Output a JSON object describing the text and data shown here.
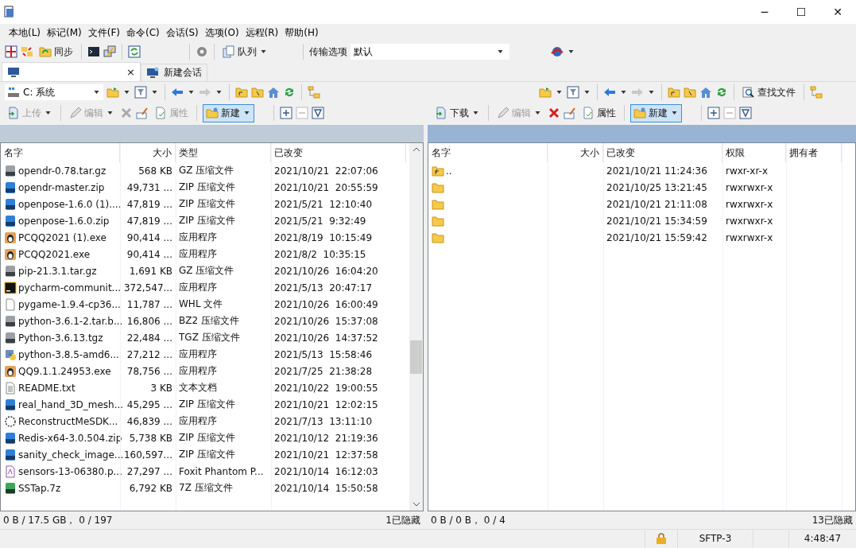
{
  "window": {
    "controls": [
      "─",
      "☐",
      "✕"
    ]
  },
  "menu": [
    "本地(L)",
    "标记(M)",
    "文件(F)",
    "命令(C)",
    "会话(S)",
    "选项(O)",
    "远程(R)",
    "帮助(H)"
  ],
  "toolbar": {
    "sync_label": "同步",
    "queue_label": "队列",
    "transfer_label": "传输选项",
    "transfer_value": "默认"
  },
  "tabs": [
    {
      "close": "×",
      "selected": true
    },
    {
      "label": "新建会话",
      "selected": false
    }
  ],
  "left": {
    "drive": "C: 系统",
    "actions": [
      {
        "label": "上传",
        "disabled": true,
        "dropdown": true
      },
      {
        "label": "编辑",
        "disabled": true,
        "dropdown": true
      },
      {
        "label": "属性",
        "disabled": true,
        "dropdown": false
      },
      {
        "label": "新建",
        "disabled": false,
        "dropdown": true
      }
    ],
    "columns": [
      "名字",
      "大小",
      "类型",
      "已改变"
    ],
    "rows": [
      {
        "kind": "archive",
        "name": "opendr-0.78.tar.gz",
        "size": "568 KB",
        "type": "GZ 压缩文件",
        "modified": "2021/10/21  22:07:06"
      },
      {
        "kind": "zip",
        "name": "opendr-master.zip",
        "size": "49,731 ...",
        "type": "ZIP 压缩文件",
        "modified": "2021/10/21  20:55:59"
      },
      {
        "kind": "zip",
        "name": "openpose-1.6.0 (1)....",
        "size": "47,819 ...",
        "type": "ZIP 压缩文件",
        "modified": "2021/5/21  12:10:40"
      },
      {
        "kind": "zip",
        "name": "openpose-1.6.0.zip",
        "size": "47,819 ...",
        "type": "ZIP 压缩文件",
        "modified": "2021/5/21  9:32:49"
      },
      {
        "kind": "penguin",
        "name": "PCQQ2021 (1).exe",
        "size": "90,414 ...",
        "type": "应用程序",
        "modified": "2021/8/19  10:15:49"
      },
      {
        "kind": "penguin",
        "name": "PCQQ2021.exe",
        "size": "90,414 ...",
        "type": "应用程序",
        "modified": "2021/8/2  10:35:15"
      },
      {
        "kind": "archive",
        "name": "pip-21.3.1.tar.gz",
        "size": "1,691 KB",
        "type": "GZ 压缩文件",
        "modified": "2021/10/26  16:04:20"
      },
      {
        "kind": "ide",
        "name": "pycharm-communit...",
        "size": "372,547...",
        "type": "应用程序",
        "modified": "2021/5/13  20:47:17"
      },
      {
        "kind": "file",
        "name": "pygame-1.9.4-cp36...",
        "size": "11,787 ...",
        "type": "WHL 文件",
        "modified": "2021/10/26  16:00:49"
      },
      {
        "kind": "archive",
        "name": "python-3.6.1-2.tar.b...",
        "size": "16,806 ...",
        "type": "BZ2 压缩文件",
        "modified": "2021/10/26  15:37:08"
      },
      {
        "kind": "archive",
        "name": "Python-3.6.13.tgz",
        "size": "22,484 ...",
        "type": "TGZ 压缩文件",
        "modified": "2021/10/26  14:37:52"
      },
      {
        "kind": "installer",
        "name": "python-3.8.5-amd6...",
        "size": "27,212 ...",
        "type": "应用程序",
        "modified": "2021/5/13  15:58:46"
      },
      {
        "kind": "penguin",
        "name": "QQ9.1.1.24953.exe",
        "size": "78,756 ...",
        "type": "应用程序",
        "modified": "2021/7/25  21:38:28"
      },
      {
        "kind": "text",
        "name": "README.txt",
        "size": "3 KB",
        "type": "文本文档",
        "modified": "2021/10/22  19:00:55"
      },
      {
        "kind": "zip",
        "name": "real_hand_3D_mesh...",
        "size": "45,295 ...",
        "type": "ZIP 压缩文件",
        "modified": "2021/10/21  12:02:15"
      },
      {
        "kind": "ring",
        "name": "ReconstructMeSDK...",
        "size": "46,839 ...",
        "type": "应用程序",
        "modified": "2021/7/13  13:11:10"
      },
      {
        "kind": "zip",
        "name": "Redis-x64-3.0.504.zip",
        "size": "5,738 KB",
        "type": "ZIP 压缩文件",
        "modified": "2021/10/12  21:19:36"
      },
      {
        "kind": "zip",
        "name": "sanity_check_image...",
        "size": "160,597...",
        "type": "ZIP 压缩文件",
        "modified": "2021/10/21  12:37:58"
      },
      {
        "kind": "pdf",
        "name": "sensors-13-06380.p...",
        "size": "27,297 ...",
        "type": "Foxit Phantom P...",
        "modified": "2021/10/14  16:12:03"
      },
      {
        "kind": "archive7z",
        "name": "SSTap.7z",
        "size": "6,792 KB",
        "type": "7Z 压缩文件",
        "modified": "2021/10/14  15:50:58"
      }
    ],
    "status": "0 B / 17.5 GB， 0 / 197",
    "hidden": "1已隐藏"
  },
  "right": {
    "find_label": "查找文件",
    "actions": [
      {
        "label": "下载",
        "disabled": false,
        "dropdown": true
      },
      {
        "label": "编辑",
        "disabled": true,
        "dropdown": true
      },
      {
        "label": "属性",
        "disabled": false,
        "dropdown": false
      },
      {
        "label": "新建",
        "disabled": false,
        "dropdown": true
      }
    ],
    "columns": [
      "名字",
      "大小",
      "已改变",
      "权限",
      "拥有者"
    ],
    "rows": [
      {
        "kind": "parent",
        "name": "..",
        "modified": "2021/10/21 11:24:36",
        "rights": "rwxr-xr-x"
      },
      {
        "kind": "folder",
        "modified": "2021/10/25 13:21:45",
        "rights": "rwxrwxr-x"
      },
      {
        "kind": "folder",
        "modified": "2021/10/21 21:11:08",
        "rights": "rwxrwxr-x"
      },
      {
        "kind": "folder",
        "modified": "2021/10/21 15:34:59",
        "rights": "rwxrwxr-x"
      },
      {
        "kind": "folder",
        "modified": "2021/10/21 15:59:42",
        "rights": "rwxrwxr-x"
      }
    ],
    "status": "0 B / 0 B， 0 / 4",
    "hidden": "13已隐藏"
  },
  "status_bar": {
    "protocol": "SFTP-3",
    "time": "4:48:47"
  }
}
